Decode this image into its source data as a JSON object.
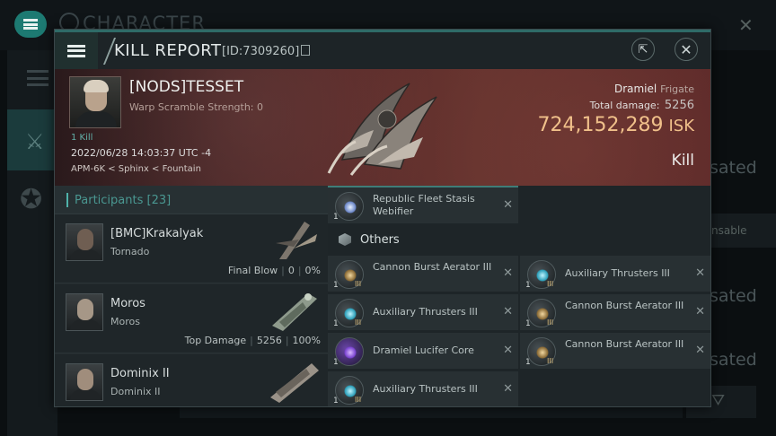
{
  "background": {
    "title": "CHARACTER",
    "right_labels": [
      "sated",
      "sated",
      "sated"
    ],
    "right_button": "nsable"
  },
  "modal": {
    "title": "KILL REPORT",
    "id_label": "[ID:7309260]",
    "victim": {
      "name": "[NODS]TESSET",
      "subtitle": "Warp Scramble Strength: 0",
      "kill_count": "1 Kill",
      "datetime": "2022/06/28 14:03:37 UTC -4",
      "location": "APM-6K < Sphinx < Fountain",
      "ship_name": "Dramiel",
      "ship_class": "Frigate",
      "total_damage_label": "Total damage:",
      "total_damage": "5256",
      "isk_value": "724,152,289",
      "isk_unit": "ISK",
      "result": "Kill"
    },
    "participants": {
      "header": "Participants [23]",
      "rows": [
        {
          "name": "[BMC]Krakalyak",
          "ship": "Tornado",
          "stat_label": "Final Blow",
          "damage": "0",
          "percent": "0%"
        },
        {
          "name": "Moros",
          "ship": "Moros",
          "stat_label": "Top Damage",
          "damage": "5256",
          "percent": "100%"
        },
        {
          "name": "Dominix II",
          "ship": "Dominix II",
          "stat_label": "",
          "damage": "",
          "percent": ""
        }
      ]
    },
    "items": {
      "top_item": {
        "name": "Republic Fleet Stasis Webifier",
        "qty": "1",
        "icon": "stasis-webifier-icon"
      },
      "category": "Others",
      "left_column": [
        {
          "name": "Cannon Burst Aerator III",
          "qty": "1",
          "level": "III",
          "icon": "aerator-icon"
        },
        {
          "name": "Auxiliary Thrusters III",
          "qty": "1",
          "level": "III",
          "icon": "thrusters-icon"
        },
        {
          "name": "Dramiel Lucifer Core",
          "qty": "1",
          "level": "",
          "icon": "core-icon"
        },
        {
          "name": "Auxiliary Thrusters III",
          "qty": "1",
          "level": "III",
          "icon": "thrusters-icon"
        }
      ],
      "right_column": [
        {
          "name": "Auxiliary Thrusters III",
          "qty": "1",
          "level": "III",
          "icon": "thrusters-icon"
        },
        {
          "name": "Cannon Burst Aerator III",
          "qty": "1",
          "level": "III",
          "icon": "aerator-icon"
        },
        {
          "name": "Cannon Burst Aerator III",
          "qty": "1",
          "level": "III",
          "icon": "aerator-icon"
        }
      ]
    }
  },
  "colors": {
    "accent": "#4fb2aa",
    "isk": "#f0c08a",
    "banner": "#5a2b2a"
  }
}
